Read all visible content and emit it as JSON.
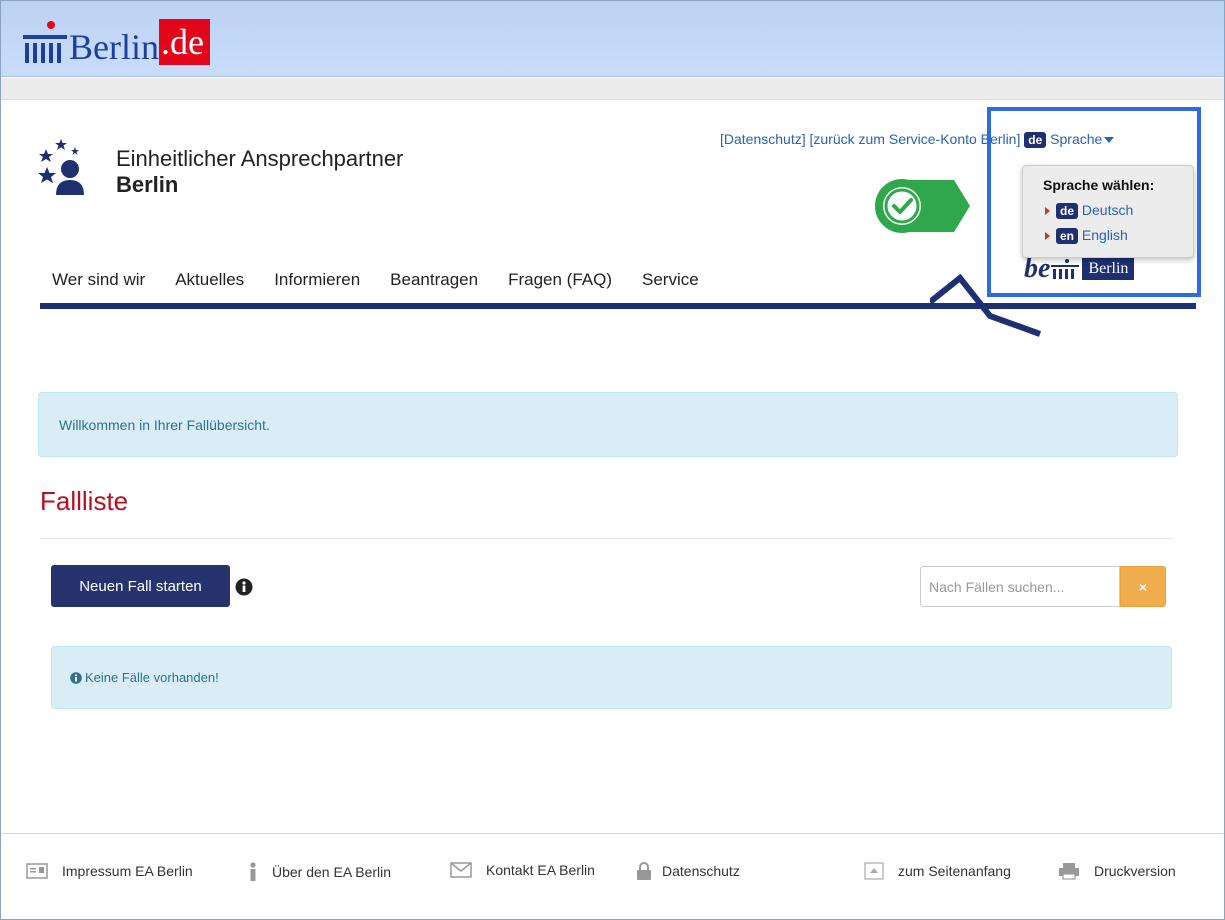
{
  "brand": {
    "word": "Berlin",
    "tld": ".de"
  },
  "header": {
    "title_line1": "Einheitlicher Ansprechpartner",
    "title_line2": "Berlin",
    "link_datenschutz": "[Datenschutz]",
    "link_back": "[zurück zum Service-Konto Berlin]",
    "lang_badge": "de",
    "lang_label": "Sprache"
  },
  "lang_dropdown": {
    "heading": "Sprache wählen:",
    "options": [
      {
        "code": "de",
        "label": "Deutsch"
      },
      {
        "code": "en",
        "label": "English"
      }
    ]
  },
  "be_berlin": {
    "be": "be",
    "berlin": "Berlin"
  },
  "nav": {
    "items": [
      "Wer sind wir",
      "Aktuelles",
      "Informieren",
      "Beantragen",
      "Fragen (FAQ)",
      "Service"
    ]
  },
  "welcome": "Willkommen in Ihrer Fallübersicht.",
  "fall_title": "Fallliste",
  "new_case_button": "Neuen Fall starten",
  "search": {
    "placeholder": "Nach Fällen suchen...",
    "clear": "×"
  },
  "no_cases": "Keine Fälle vorhanden!",
  "footer": {
    "impressum": "Impressum EA Berlin",
    "ueber": "Über den EA Berlin",
    "kontakt": "Kontakt EA Berlin",
    "datenschutz": "Datenschutz",
    "top": "zum Seitenanfang",
    "druck": "Druckversion"
  },
  "colors": {
    "navy": "#1e2f72",
    "red": "#b3111f",
    "info_bg": "#d9edf7",
    "warning": "#f0ad4e",
    "highlight": "#2d6be4"
  }
}
